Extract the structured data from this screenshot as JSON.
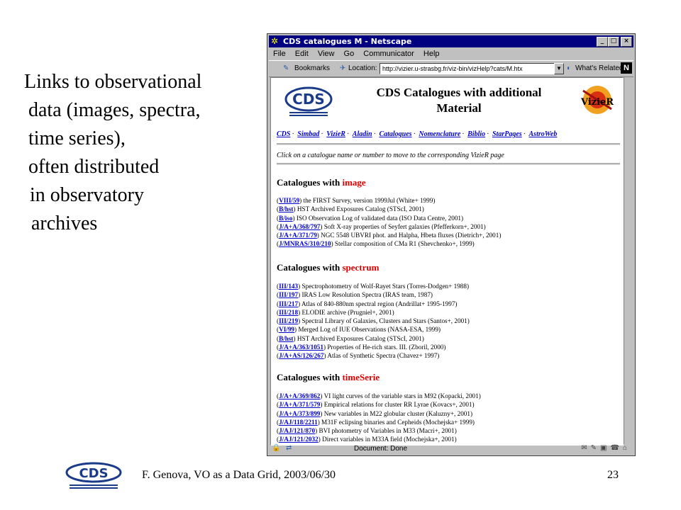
{
  "slide": {
    "bullet_lines": [
      "Links to observational",
      "data (images, spectra,",
      "time series),",
      "often distributed",
      "in observatory",
      "archives"
    ],
    "footer_text": "F. Genova, VO as a Data Grid, 2003/06/30",
    "page_number": "23"
  },
  "browser": {
    "title": "CDS catalogues M - Netscape",
    "menu": [
      "File",
      "Edit",
      "View",
      "Go",
      "Communicator",
      "Help"
    ],
    "bookmarks_label": "Bookmarks",
    "location_label": "Location:",
    "url": "http://vizier.u-strasbg.fr/viz-bin/vizHelp?cats/M.htx",
    "whats_related": "What's Related",
    "status": "Document: Done"
  },
  "page": {
    "title_line1": "CDS Catalogues with additional",
    "title_line2": "Material",
    "nav_links": [
      "CDS",
      "Simbad",
      "VizieR",
      "Aladin",
      "Catalogues",
      "Nomenclature",
      "Biblio",
      "StarPages",
      "AstroWeb"
    ],
    "instructions": "Click on a catalogue name or number to move to the corresponding VizieR page",
    "sections": [
      {
        "prefix": "Catalogues with ",
        "keyword": "image",
        "entries": [
          {
            "id": "VIII/59",
            "desc": " the FIRST Survey, version 1999Jul (White+ 1999)"
          },
          {
            "id": "B/hst",
            "desc": " HST Archived Exposures Catalog (STScI, 2001)"
          },
          {
            "id": "B/iso",
            "desc": " ISO Observation Log of validated data (ISO Data Centre, 2001)"
          },
          {
            "id": "J/A+A/368/797",
            "desc": " Soft X-ray properties of Seyfert galaxies (Pfefferkorn+, 2001)"
          },
          {
            "id": "J/A+A/371/79",
            "desc": " NGC 5548 UBVRI phot. and Halpha, Hbeta fluxes (Dietrich+, 2001)"
          },
          {
            "id": "J/MNRAS/310/210",
            "desc": " Stellar composition of CMa R1 (Shevchenko+, 1999)"
          }
        ]
      },
      {
        "prefix": "Catalogues with ",
        "keyword": "spectrum",
        "entries": [
          {
            "id": "III/143",
            "desc": " Spectrophotometry of Wolf-Rayet Stars (Torres-Dodgen+ 1988)"
          },
          {
            "id": "III/197",
            "desc": " IRAS Low Resolution Spectra (IRAS team, 1987)"
          },
          {
            "id": "III/217",
            "desc": " Atlas of 840-880nm spectral region (Andrillat+ 1995-1997)"
          },
          {
            "id": "III/218",
            "desc": " ELODIE archive (Prugniel+, 2001)"
          },
          {
            "id": "III/219",
            "desc": " Spectral Library of Galaxies, Clusters and Stars (Santos+, 2001)"
          },
          {
            "id": "VI/99",
            "desc": " Merged Log of IUE Observations (NASA-ESA, 1999)"
          },
          {
            "id": "B/hst",
            "desc": " HST Archived Exposures Catalog (STScI, 2001)"
          },
          {
            "id": "J/A+A/363/1051",
            "desc": " Properties of He-rich stars. III. (Zboril, 2000)"
          },
          {
            "id": "J/A+AS/126/267",
            "desc": " Atlas of Synthetic Spectra (Chavez+ 1997)"
          }
        ]
      },
      {
        "prefix": "Catalogues with ",
        "keyword": "timeSerie",
        "entries": [
          {
            "id": "J/A+A/369/862",
            "desc": " VI light curves of the variable stars in M92 (Kopacki, 2001)"
          },
          {
            "id": "J/A+A/371/579",
            "desc": " Empirical relations for cluster RR Lyrae (Kovacs+, 2001)"
          },
          {
            "id": "J/A+A/373/899",
            "desc": " New variables in M22 globular cluster (Kaluzny+, 2001)"
          },
          {
            "id": "J/AJ/118/2211",
            "desc": " M31F eclipsing binaries and Cepheids (Mochejska+ 1999)"
          },
          {
            "id": "J/AJ/121/870",
            "desc": " BVI photometry of Variables in M33 (Macri+, 2001)"
          },
          {
            "id": "J/AJ/121/2032",
            "desc": " Direct variables in M33A field (Mochejska+, 2001)"
          }
        ]
      }
    ]
  },
  "colors": {
    "titlebar": "#000080",
    "link": "#0000cc",
    "keyword_red": "#e00000",
    "chrome_gray": "#c0c0c0"
  }
}
